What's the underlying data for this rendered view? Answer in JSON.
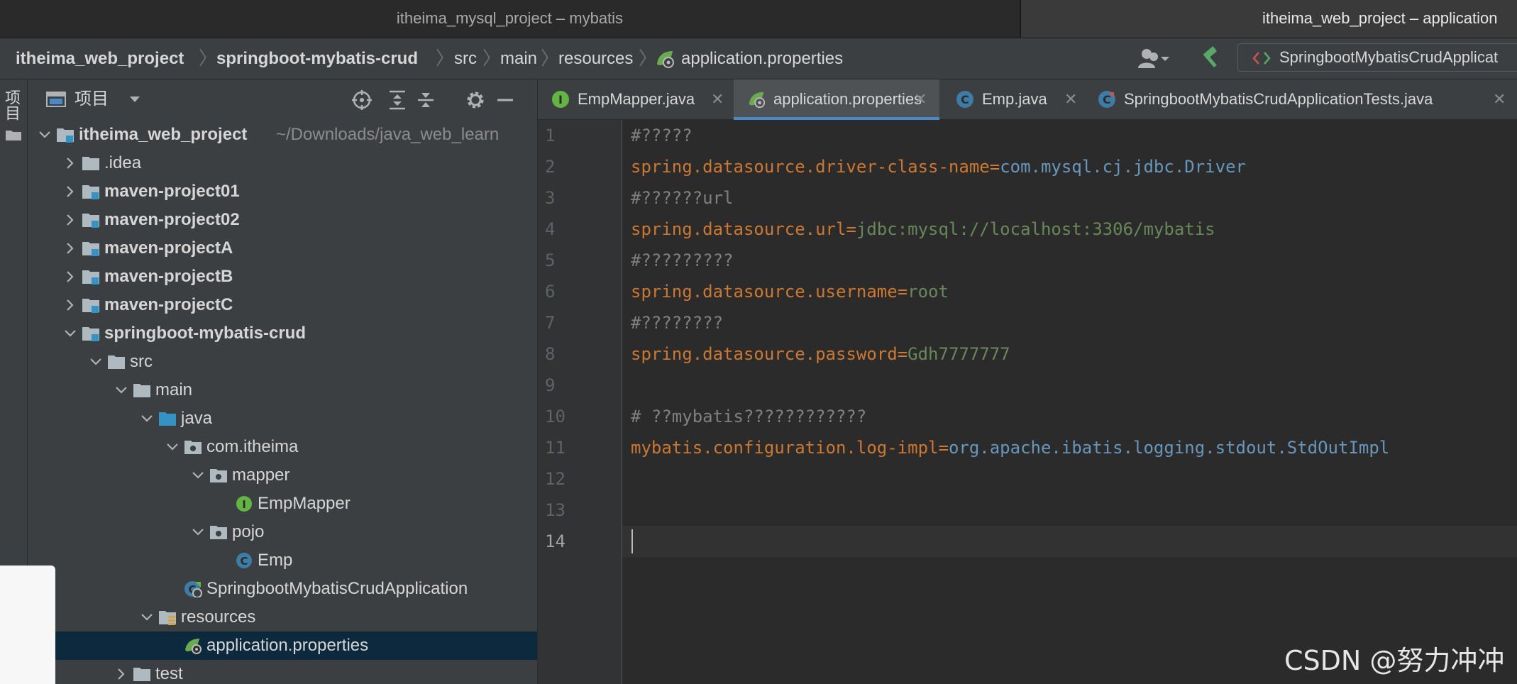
{
  "window_tabs": [
    {
      "title": "itheima_mysql_project – mybatis"
    },
    {
      "title": "itheima_web_project – application"
    }
  ],
  "breadcrumb": [
    "itheima_web_project",
    "springboot-mybatis-crud",
    "src",
    "main",
    "resources",
    "application.properties"
  ],
  "run_config": {
    "label": "SpringbootMybatisCrudApplicat"
  },
  "toolstrip": {
    "label": "项目"
  },
  "project_panel": {
    "title": "项目",
    "tree": [
      {
        "label": "itheima_web_project",
        "path": "~/Downloads/java_web_learn",
        "icon": "module-folder-icon",
        "bold": true,
        "expanded": true
      },
      {
        "label": ".idea",
        "icon": "folder-icon",
        "bold": false,
        "expanded": false
      },
      {
        "label": "maven-project01",
        "icon": "module-folder-icon",
        "bold": true,
        "expanded": false
      },
      {
        "label": "maven-project02",
        "icon": "module-folder-icon",
        "bold": true,
        "expanded": false
      },
      {
        "label": "maven-projectA",
        "icon": "module-folder-icon",
        "bold": true,
        "expanded": false
      },
      {
        "label": "maven-projectB",
        "icon": "module-folder-icon",
        "bold": true,
        "expanded": false
      },
      {
        "label": "maven-projectC",
        "icon": "module-folder-icon",
        "bold": true,
        "expanded": false
      },
      {
        "label": "springboot-mybatis-crud",
        "icon": "module-folder-icon",
        "bold": true,
        "expanded": true
      },
      {
        "label": "src",
        "icon": "folder-icon",
        "bold": false,
        "expanded": true
      },
      {
        "label": "main",
        "icon": "folder-icon",
        "bold": false,
        "expanded": true
      },
      {
        "label": "java",
        "icon": "source-folder-icon",
        "bold": false,
        "expanded": true
      },
      {
        "label": "com.itheima",
        "icon": "package-icon",
        "bold": false,
        "expanded": true
      },
      {
        "label": "mapper",
        "icon": "package-icon",
        "bold": false,
        "expanded": true
      },
      {
        "label": "EmpMapper",
        "icon": "interface-icon",
        "bold": false
      },
      {
        "label": "pojo",
        "icon": "package-icon",
        "bold": false,
        "expanded": true
      },
      {
        "label": "Emp",
        "icon": "class-icon",
        "bold": false
      },
      {
        "label": "SpringbootMybatisCrudApplication",
        "icon": "spring-boot-class-icon",
        "bold": false
      },
      {
        "label": "resources",
        "icon": "resources-folder-icon",
        "bold": false,
        "expanded": true
      },
      {
        "label": "application.properties",
        "icon": "spring-properties-icon",
        "bold": false,
        "selected": true
      },
      {
        "label": "test",
        "icon": "folder-icon",
        "bold": false,
        "expanded": false
      }
    ]
  },
  "editor_tabs": [
    {
      "label": "EmpMapper.java",
      "icon": "interface-icon"
    },
    {
      "label": "application.properties",
      "icon": "spring-properties-icon",
      "active": true
    },
    {
      "label": "Emp.java",
      "icon": "class-icon"
    },
    {
      "label": "SpringbootMybatisCrudApplicationTests.java",
      "icon": "spring-test-class-icon"
    }
  ],
  "editor": {
    "current_line": 14,
    "lines": [
      {
        "n": "1",
        "comment": "#?????"
      },
      {
        "n": "2",
        "key": "spring.datasource.driver-class-name",
        "value": "com.mysql.cj.jdbc.Driver",
        "value_kind": "class"
      },
      {
        "n": "3",
        "comment": "#??????url"
      },
      {
        "n": "4",
        "key": "spring.datasource.url",
        "value": "jdbc:mysql://localhost:3306/mybatis",
        "value_kind": "string"
      },
      {
        "n": "5",
        "comment": "#?????????"
      },
      {
        "n": "6",
        "key": "spring.datasource.username",
        "value": "root",
        "value_kind": "string"
      },
      {
        "n": "7",
        "comment": "#????????"
      },
      {
        "n": "8",
        "key": "spring.datasource.password",
        "value": "Gdh7777777",
        "value_kind": "string"
      },
      {
        "n": "9"
      },
      {
        "n": "10",
        "comment": "# ??mybatis????????????"
      },
      {
        "n": "11",
        "key": "mybatis.configuration.log-impl",
        "value": "org.apache.ibatis.logging.stdout.StdOutImpl",
        "value_kind": "class"
      },
      {
        "n": "12"
      },
      {
        "n": "13"
      },
      {
        "n": "14"
      }
    ]
  },
  "watermark": "CSDN @努力冲冲",
  "colors": {
    "key": "#cc7832",
    "string_value": "#6a8759",
    "class_value": "#6897bb",
    "comment": "#808080",
    "selection": "#0d293e",
    "active_tab_underline": "#4a88c7"
  }
}
